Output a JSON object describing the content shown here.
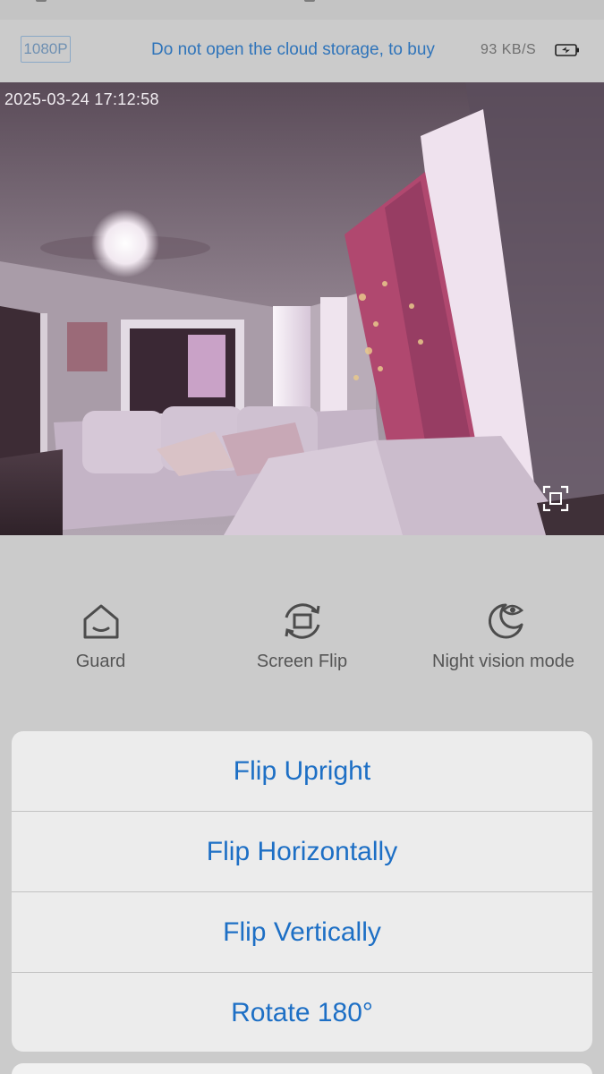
{
  "info_bar": {
    "resolution": "1080P",
    "cloud_message": "Do not open the cloud storage, to buy",
    "speed": "93 KB/S",
    "battery_icon": "battery-charging-icon"
  },
  "video": {
    "timestamp": "2025-03-24 17:12:58",
    "fullscreen_icon": "fullscreen-icon"
  },
  "controls": [
    {
      "label": "Guard",
      "icon": "home-guard-icon"
    },
    {
      "label": "Screen Flip",
      "icon": "screen-flip-icon"
    },
    {
      "label": "Night vision mode",
      "icon": "night-vision-icon"
    }
  ],
  "action_sheet": {
    "items": [
      "Flip Upright",
      "Flip Horizontally",
      "Flip Vertically",
      "Rotate 180°"
    ]
  },
  "colors": {
    "accent": "#1d6fc5",
    "link": "#2f74ba",
    "dim_background": "#cbcbcb"
  }
}
